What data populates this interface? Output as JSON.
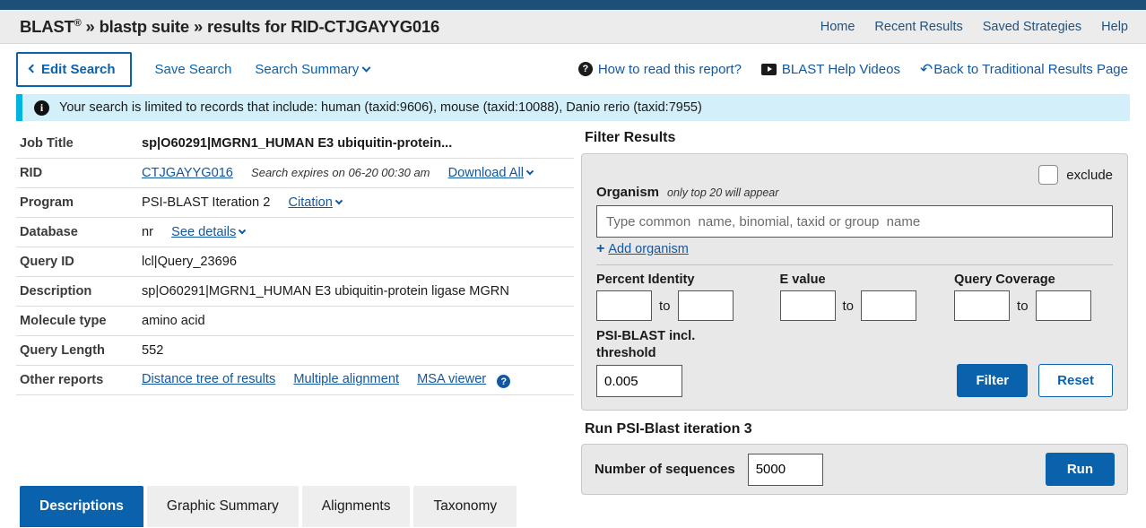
{
  "header": {
    "brand": "BLAST",
    "registered": "®",
    "breadcrumb_sep1": "»",
    "suite": "blastp suite",
    "breadcrumb_sep2": "»",
    "results_for": "results for RID-CTJGAYYG016",
    "nav": [
      {
        "label": "Home",
        "name": "nav-home"
      },
      {
        "label": "Recent Results",
        "name": "nav-recent-results"
      },
      {
        "label": "Saved Strategies",
        "name": "nav-saved-strategies"
      },
      {
        "label": "Help",
        "name": "nav-help"
      }
    ]
  },
  "toolbar": {
    "edit_search": "Edit Search",
    "save_search": "Save Search",
    "search_summary": "Search Summary",
    "how_to_read": "How to read this report?",
    "help_videos": "BLAST Help Videos",
    "back_traditional": "Back to Traditional Results Page",
    "icons": {
      "qmark": "question-circle-icon",
      "video": "video-icon",
      "undo": "undo-icon"
    }
  },
  "banner": {
    "icon": "info-icon",
    "text": "Your search is limited to records that include: human (taxid:9606), mouse (taxid:10088), Danio rerio (taxid:7955)",
    "accent_color": "#00b5e2",
    "bg_color": "#d3f0fa"
  },
  "info_table": {
    "job_title_label": "Job Title",
    "job_title_value": "sp|O60291|MGRN1_HUMAN E3 ubiquitin-protein...",
    "rid_label": "RID",
    "rid_value": "CTJGAYYG016",
    "rid_expires": "Search expires on 06-20 00:30 am",
    "download_all": "Download All",
    "program_label": "Program",
    "program_value": "PSI-BLAST Iteration 2",
    "citation": "Citation",
    "database_label": "Database",
    "database_value": "nr",
    "see_details": "See details",
    "query_id_label": "Query ID",
    "query_id_value": "lcl|Query_23696",
    "description_label": "Description",
    "description_value": "sp|O60291|MGRN1_HUMAN E3 ubiquitin-protein ligase MGRN",
    "molecule_type_label": "Molecule type",
    "molecule_type_value": "amino acid",
    "query_length_label": "Query Length",
    "query_length_value": "552",
    "other_reports_label": "Other reports",
    "other_reports": [
      {
        "label": "Distance tree of results",
        "name": "distance-tree-link"
      },
      {
        "label": "Multiple alignment",
        "name": "multiple-alignment-link"
      },
      {
        "label": "MSA viewer",
        "name": "msa-viewer-link"
      }
    ]
  },
  "filter": {
    "title": "Filter Results",
    "organism_label": "Organism",
    "organism_note": "only top 20 will appear",
    "organism_placeholder": "Type common  name, binomial, taxid or group  name",
    "organism_value": "",
    "exclude_label": "exclude",
    "exclude_checked": false,
    "add_organism": "Add organism",
    "percent_identity_label": "Percent Identity",
    "percent_identity_from": "",
    "percent_identity_to": "",
    "e_value_label": "E value",
    "e_value_from": "",
    "e_value_to": "",
    "query_coverage_label": "Query Coverage",
    "query_coverage_from": "",
    "query_coverage_to": "",
    "to_label": "to",
    "psi_threshold_label_line1": "PSI-BLAST incl.",
    "psi_threshold_label_line2": "threshold",
    "psi_threshold_value": "0.005",
    "filter_button": "Filter",
    "reset_button": "Reset",
    "primary_color": "#0b62ac"
  },
  "run_section": {
    "title": "Run PSI-Blast iteration 3",
    "num_sequences_label": "Number of sequences",
    "num_sequences_value": "5000",
    "run_button": "Run"
  },
  "tabs": [
    {
      "label": "Descriptions",
      "name": "tab-descriptions",
      "active": true
    },
    {
      "label": "Graphic Summary",
      "name": "tab-graphic-summary",
      "active": false
    },
    {
      "label": "Alignments",
      "name": "tab-alignments",
      "active": false
    },
    {
      "label": "Taxonomy",
      "name": "tab-taxonomy",
      "active": false
    }
  ]
}
